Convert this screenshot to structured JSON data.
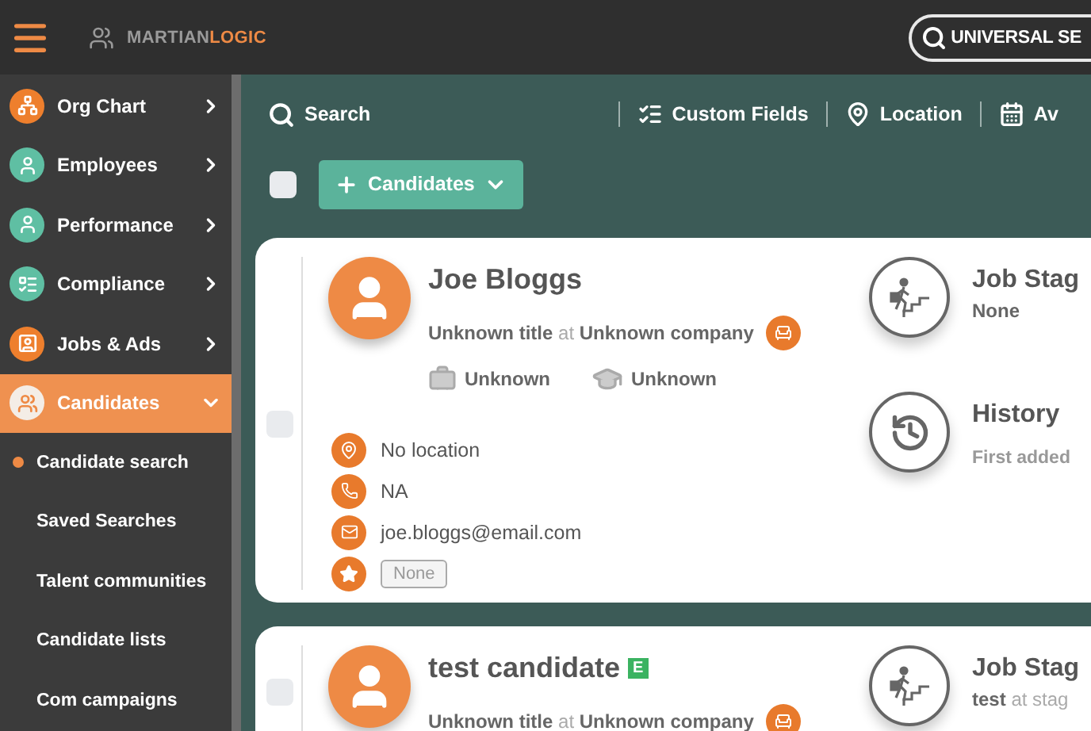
{
  "top_bar": {
    "brand": {
      "first": "MARTIAN",
      "second": "LOGIC"
    },
    "universal_search": "UNIVERSAL SE"
  },
  "sidebar": {
    "items": [
      {
        "kind": "menu",
        "label": "Org Chart",
        "color": "#ee7f2d",
        "selected": false,
        "expanded": false
      },
      {
        "kind": "menu",
        "label": "Employees",
        "color": "#5fbfa3",
        "selected": false,
        "expanded": false
      },
      {
        "kind": "menu",
        "label": "Performance",
        "color": "#5fbfa3",
        "selected": false,
        "expanded": false
      },
      {
        "kind": "menu",
        "label": "Compliance",
        "color": "#5fbfa3",
        "selected": false,
        "expanded": false
      },
      {
        "kind": "menu",
        "label": "Jobs & Ads",
        "color": "#ee7f2d",
        "selected": false,
        "expanded": false
      },
      {
        "kind": "menu",
        "label": "Candidates",
        "color": "#f4ede6",
        "selected": true,
        "expanded": true,
        "children": [
          {
            "label": "Candidate search",
            "selected": true
          },
          {
            "label": "Saved Searches",
            "selected": false
          },
          {
            "label": "Talent communities",
            "selected": false
          },
          {
            "label": "Candidate lists",
            "selected": false
          },
          {
            "label": "Com campaigns",
            "selected": false
          }
        ]
      }
    ]
  },
  "toolbar": {
    "search": "Search",
    "items": [
      {
        "label": "Custom Fields"
      },
      {
        "label": "Location"
      },
      {
        "label": "Av"
      }
    ]
  },
  "actions": {
    "select_all": {
      "checked": false
    },
    "button": "Candidates"
  },
  "candidates": [
    {
      "name": "Joe Bloggs",
      "title": "Unknown title",
      "at": "at",
      "company": "Unknown company",
      "work": "Unknown",
      "education": "Unknown",
      "location": "No location",
      "phone": "NA",
      "email": "joe.bloggs@email.com",
      "rating": "None",
      "checked": false,
      "job_stage": {
        "title": "Job Stag",
        "value": "None"
      },
      "history": {
        "title": "History",
        "text": "First added"
      }
    },
    {
      "name": "test candidate",
      "badge": "E",
      "title": "Unknown title",
      "at": "at",
      "company": "Unknown company",
      "checked": false,
      "job_stage": {
        "title": "Job Stag",
        "value": "test",
        "connector": "at",
        "stage": "stag"
      }
    }
  ]
}
